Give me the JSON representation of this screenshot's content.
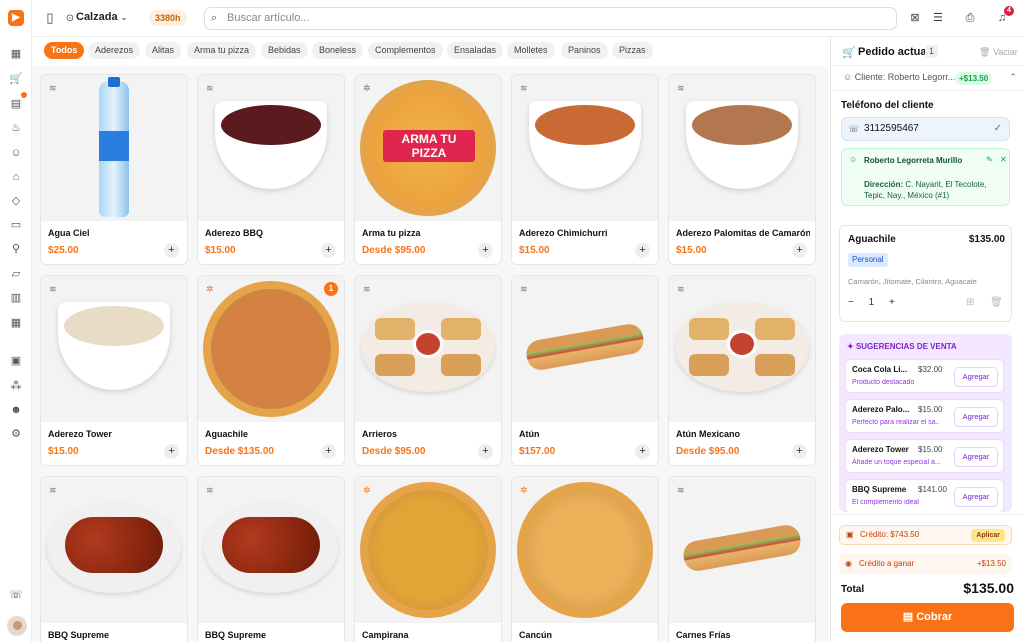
{
  "topbar": {
    "location": "Calzada",
    "hours_badge": "3380h",
    "search_placeholder": "Buscar artículo...",
    "notifications_count": "4"
  },
  "categories": [
    "Todos",
    "Aderezos",
    "Alitas",
    "Arma tu pizza",
    "Bebidas",
    "Boneless",
    "Complementos",
    "Ensaladas",
    "Molletes",
    "Paninos",
    "Pizzas"
  ],
  "products": [
    {
      "name": "Agua Ciel",
      "price": "$25.00",
      "image": "bottle"
    },
    {
      "name": "Aderezo BBQ",
      "price": "$15.00",
      "image": "bowl",
      "color": "#5a1a1e"
    },
    {
      "name": "Arma tu pizza",
      "price": "Desde $95.00",
      "image": "pizza-banner",
      "banner": "ARMA TU PIZZA"
    },
    {
      "name": "Aderezo Chimichurri",
      "price": "$15.00",
      "image": "bowl",
      "color": "#c96a34"
    },
    {
      "name": "Aderezo Palomitas de Camarón",
      "price": "$15.00",
      "image": "bowl",
      "color": "#b2774f"
    },
    {
      "name": "Aderezo Tower",
      "price": "$15.00",
      "image": "bowl",
      "color": "#e8dcc6"
    },
    {
      "name": "Aguachile",
      "price": "Desde $135.00",
      "image": "pizza",
      "color": "#d68045",
      "count": "1"
    },
    {
      "name": "Arrieros",
      "price": "Desde $95.00",
      "image": "plate"
    },
    {
      "name": "Atún",
      "price": "$157.00",
      "image": "sub"
    },
    {
      "name": "Atún Mexicano",
      "price": "Desde $95.00",
      "image": "plate"
    },
    {
      "name": "BBQ Supreme",
      "price": "",
      "image": "wings"
    },
    {
      "name": "BBQ Supreme",
      "price": "",
      "image": "wings"
    },
    {
      "name": "Campirana",
      "price": "",
      "image": "pizza",
      "color": "#e3a437"
    },
    {
      "name": "Cancún",
      "price": "",
      "image": "pizza",
      "color": "#eab159"
    },
    {
      "name": "Carnes Frías",
      "price": "",
      "image": "sub"
    }
  ],
  "order": {
    "title": "Pedido actual",
    "count": "1",
    "clear_label": "Vaciar",
    "client_summary": "Cliente: Roberto Legorr...",
    "points": "+$13.50",
    "phone_label": "Teléfono del cliente",
    "phone": "3112595467",
    "customer_name": "Roberto Legorreta Murillo",
    "address_label": "Dirección:",
    "address": "C. Nayarit, El Tecolote, Tepic, Nay., México (#1)",
    "item": {
      "name": "Aguachile",
      "price": "$135.00",
      "size": "Personal",
      "ingredients": "Camarón, Jitomate, Cilantro, Aguacate",
      "qty": "1"
    },
    "suggestions_title": "SUGERENCIAS DE VENTA",
    "suggestions": [
      {
        "name": "Coca Cola Li...",
        "price": "$32.00",
        "desc": "Producto destacado",
        "button": "Agregar"
      },
      {
        "name": "Aderezo Palo...",
        "price": "$15.00",
        "desc": "Perfecto para realizar el sa...",
        "button": "Agregar"
      },
      {
        "name": "Aderezo Tower",
        "price": "$15.00",
        "desc": "Añade un toque especial a...",
        "button": "Agregar"
      },
      {
        "name": "BBQ Supreme",
        "price": "$141.00",
        "desc": "El complemento ideal",
        "button": "Agregar"
      }
    ],
    "credit_label": "Crédito: $743.50",
    "apply_label": "Aplicar",
    "earn_label": "Crédito a ganar",
    "earn_value": "+$13.50",
    "total_label": "Total",
    "total": "$135.00",
    "pay_label": "Cobrar"
  },
  "colors": {
    "accent": "#f97316",
    "success": "#16a34a",
    "promo": "#7e22ce"
  }
}
